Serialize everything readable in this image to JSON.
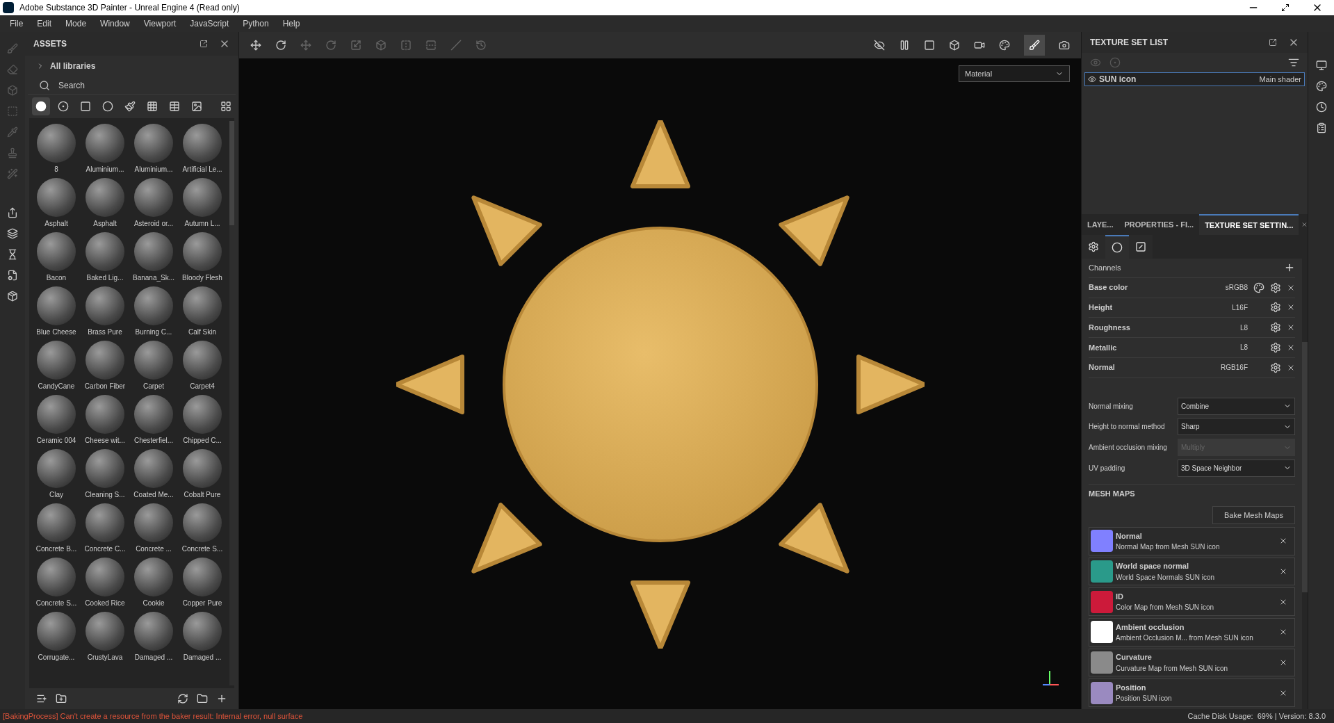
{
  "window": {
    "title": "Adobe Substance 3D Painter - Unreal Engine 4 (Read only)"
  },
  "menu": [
    "File",
    "Edit",
    "Mode",
    "Window",
    "Viewport",
    "JavaScript",
    "Python",
    "Help"
  ],
  "assets": {
    "title": "ASSETS",
    "library": "All libraries",
    "search": {
      "placeholder": "Search"
    },
    "filters": [
      {
        "selected": true
      },
      {
        "selected": false
      },
      {
        "selected": false
      },
      {
        "selected": false
      },
      {
        "selected": false
      },
      {
        "selected": false
      },
      {
        "selected": false
      },
      {
        "selected": false
      }
    ],
    "items": [
      {
        "name": "8"
      },
      {
        "name": "Aluminium..."
      },
      {
        "name": "Aluminium..."
      },
      {
        "name": "Artificial Le..."
      },
      {
        "name": "Asphalt"
      },
      {
        "name": "Asphalt"
      },
      {
        "name": "Asteroid or..."
      },
      {
        "name": "Autumn L..."
      },
      {
        "name": "Bacon"
      },
      {
        "name": "Baked Lig..."
      },
      {
        "name": "Banana_Sk..."
      },
      {
        "name": "Bloody Flesh"
      },
      {
        "name": "Blue Cheese"
      },
      {
        "name": "Brass Pure"
      },
      {
        "name": "Burning C..."
      },
      {
        "name": "Calf Skin"
      },
      {
        "name": "CandyCane"
      },
      {
        "name": "Carbon Fiber"
      },
      {
        "name": "Carpet"
      },
      {
        "name": "Carpet4"
      },
      {
        "name": "Ceramic 004"
      },
      {
        "name": "Cheese wit..."
      },
      {
        "name": "Chesterfiel..."
      },
      {
        "name": "Chipped C..."
      },
      {
        "name": "Clay"
      },
      {
        "name": "Cleaning S..."
      },
      {
        "name": "Coated Me..."
      },
      {
        "name": "Cobalt Pure"
      },
      {
        "name": "Concrete B..."
      },
      {
        "name": "Concrete C..."
      },
      {
        "name": "Concrete ..."
      },
      {
        "name": "Concrete S..."
      },
      {
        "name": "Concrete S..."
      },
      {
        "name": "Cooked Rice"
      },
      {
        "name": "Cookie"
      },
      {
        "name": "Copper Pure"
      },
      {
        "name": "Corrugate..."
      },
      {
        "name": "CrustyLava"
      },
      {
        "name": "Damaged ..."
      },
      {
        "name": "Damaged ..."
      }
    ]
  },
  "viewport": {
    "mode": "Material"
  },
  "texture_set_list": {
    "title": "TEXTURE SET LIST",
    "sets": [
      {
        "name": "SUN icon",
        "shader": "Main shader",
        "selected": true
      }
    ]
  },
  "tabs": [
    {
      "label": "LAYE...",
      "selected": false
    },
    {
      "label": "PROPERTIES - FI...",
      "selected": false
    },
    {
      "label": "TEXTURE SET SETTIN...",
      "selected": true
    }
  ],
  "subtabs": [
    {
      "selected": false
    },
    {
      "selected": true
    },
    {
      "selected": false
    }
  ],
  "channels": {
    "title": "Channels",
    "items": [
      {
        "name": "Base color",
        "format": "sRGB8",
        "kind": "color"
      },
      {
        "name": "Height",
        "format": "L16F",
        "kind": "plain"
      },
      {
        "name": "Roughness",
        "format": "L8",
        "kind": "plain"
      },
      {
        "name": "Metallic",
        "format": "L8",
        "kind": "plain"
      },
      {
        "name": "Normal",
        "format": "RGB16F",
        "kind": "plain"
      }
    ]
  },
  "settings": [
    {
      "label": "Normal mixing",
      "value": "Combine",
      "disabled": false
    },
    {
      "label": "Height to normal method",
      "value": "Sharp",
      "disabled": false
    },
    {
      "label": "Ambient occlusion mixing",
      "value": "Multiply",
      "disabled": true
    },
    {
      "label": "UV padding",
      "value": "3D Space Neighbor",
      "disabled": false
    }
  ],
  "mesh_maps": {
    "title": "MESH MAPS",
    "bake_button": "Bake Mesh Maps",
    "items": [
      {
        "name": "Normal",
        "source": "Normal Map from Mesh SUN icon",
        "color": "#8080ff"
      },
      {
        "name": "World space normal",
        "source": "World Space Normals SUN icon",
        "color": "#2a9a8a"
      },
      {
        "name": "ID",
        "source": "Color Map from Mesh SUN icon",
        "color": "#cc1a3a"
      },
      {
        "name": "Ambient occlusion",
        "source": "Ambient Occlusion M... from Mesh SUN icon",
        "color": "#ffffff"
      },
      {
        "name": "Curvature",
        "source": "Curvature Map from Mesh SUN icon",
        "color": "#8a8a8a"
      },
      {
        "name": "Position",
        "source": "Position SUN icon",
        "color": "#9a8ac0"
      }
    ]
  },
  "status_bar": {
    "error": "[BakingProcess] Can't create a resource from the baker result: Internal error, null surface",
    "info": "Cache Disk Usage:  69% | Version: 8.3.0"
  }
}
